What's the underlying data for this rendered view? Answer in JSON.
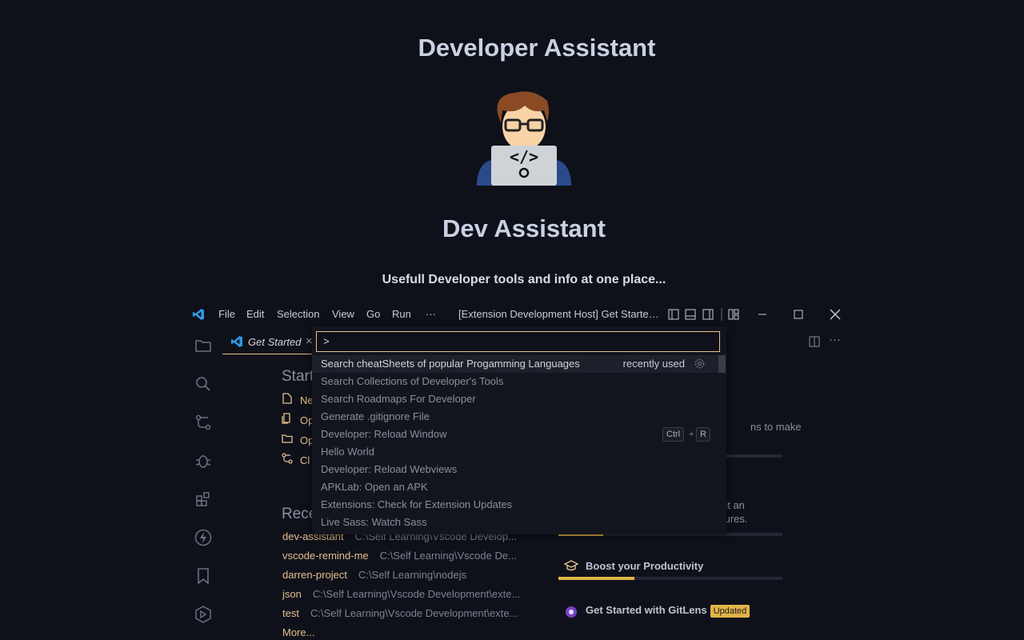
{
  "hero": {
    "title": "Developer Assistant",
    "subtitle": "Dev Assistant",
    "tagline": "Usefull Developer tools and info at one place..."
  },
  "titlebar": {
    "menu": [
      "File",
      "Edit",
      "Selection",
      "View",
      "Go",
      "Run",
      "···"
    ],
    "window_title": "[Extension Development Host] Get Started - Visual Studio Code"
  },
  "tab": {
    "label": "Get Started",
    "close": "×"
  },
  "start": {
    "heading": "Start",
    "items": [
      "Ne",
      "Op",
      "Op",
      "Cl"
    ]
  },
  "recent": {
    "heading": "Rece",
    "rows": [
      {
        "name": "dev-assistant",
        "path": "C:\\Self Learning\\Vscode Develop..."
      },
      {
        "name": "vscode-remind-me",
        "path": "C:\\Self Learning\\Vscode De..."
      },
      {
        "name": "darren-project",
        "path": "C:\\Self Learning\\nodejs"
      },
      {
        "name": "json",
        "path": "C:\\Self Learning\\Vscode Development\\exte..."
      },
      {
        "name": "test",
        "path": "C:\\Self Learning\\Vscode Development\\exte..."
      }
    ],
    "more": "More..."
  },
  "walkthroughs": {
    "partial_1": "ns to make",
    "partial_2a": "et an",
    "partial_2b": "tures.",
    "boost": "Boost your Productivity",
    "gitlens": "Get Started with GitLens",
    "gitlens_badge": "Updated",
    "progress": [
      0.09,
      0.2,
      0.34,
      0.0
    ]
  },
  "palette": {
    "input_value": ">",
    "commands": [
      {
        "label": "Search cheatSheets of popular Progamming Languages",
        "tag": "recently used"
      },
      {
        "label": "Search Collections of Developer's Tools"
      },
      {
        "label": "Search Roadmaps For Developer"
      },
      {
        "label": "Generate .gitignore File"
      },
      {
        "label": "Developer: Reload Window",
        "keys": [
          "Ctrl",
          "R"
        ]
      },
      {
        "label": "Hello World"
      },
      {
        "label": "Developer: Reload Webviews"
      },
      {
        "label": "APKLab: Open an APK"
      },
      {
        "label": "Extensions: Check for Extension Updates"
      },
      {
        "label": "Live Sass: Watch Sass"
      }
    ],
    "key_separator": "+"
  },
  "colors": {
    "accent": "#e2c08d",
    "progress": "#e2b54a",
    "background": "#0f111a"
  }
}
